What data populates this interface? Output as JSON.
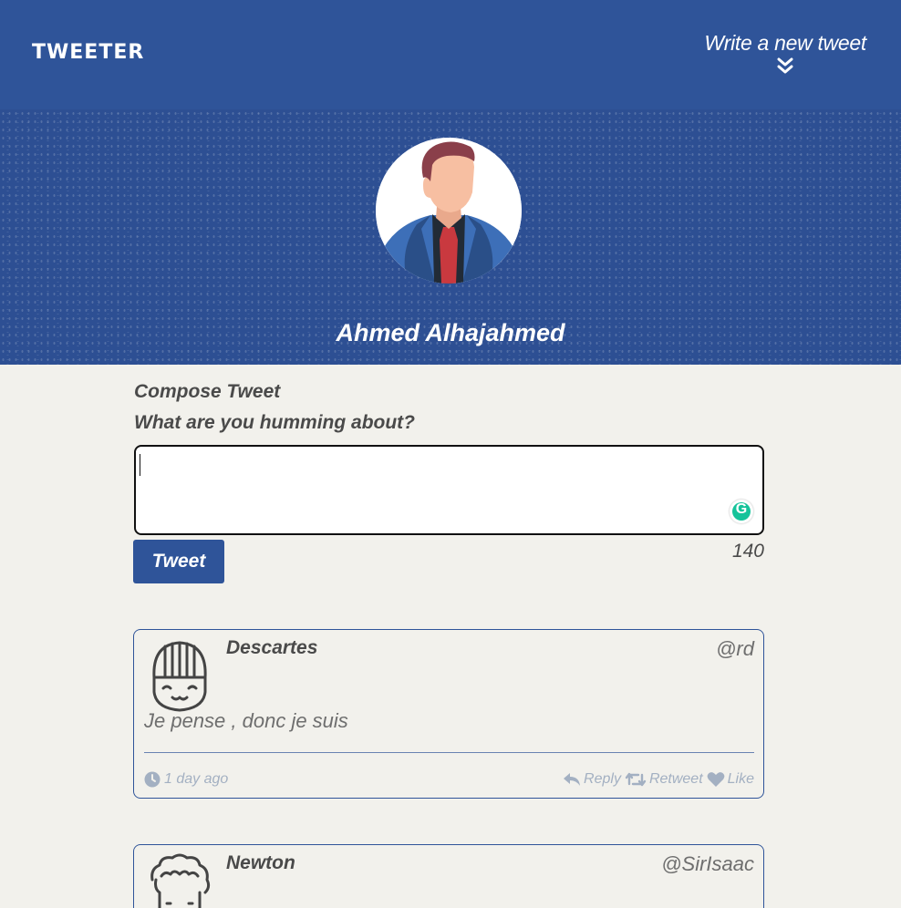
{
  "nav": {
    "brand": "TWEETER",
    "new_tweet_label": "Write a new tweet"
  },
  "profile": {
    "name": "Ahmed Alhajahmed"
  },
  "compose": {
    "title": "Compose Tweet",
    "prompt": "What are you humming about?",
    "text": "",
    "button_label": "Tweet",
    "counter": "140",
    "grammarly_letter": "G"
  },
  "tweets": [
    {
      "name": "Descartes",
      "handle": "@rd",
      "text": "Je pense , donc je suis",
      "time": "1 day ago"
    },
    {
      "name": "Newton",
      "handle": "@SirIsaac"
    }
  ],
  "actions": {
    "reply": "Reply",
    "retweet": "Retweet",
    "like": "Like"
  },
  "colors": {
    "primary": "#2f5499",
    "background": "#f2f1ec",
    "muted_action": "#a3b0c2"
  },
  "icons": {
    "nav_toggle": "double-chevron-down-icon",
    "time": "clock-icon",
    "reply": "reply-arrow-icon",
    "retweet": "retweet-icon",
    "like": "heart-icon"
  }
}
